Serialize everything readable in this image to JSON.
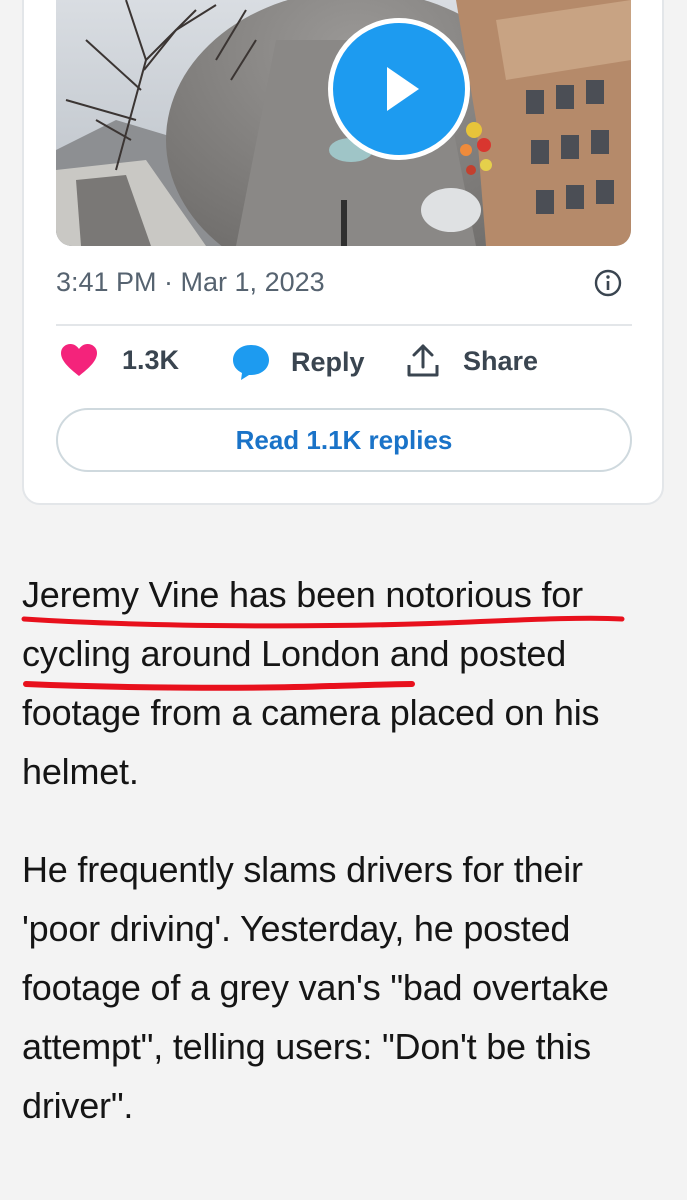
{
  "tweet": {
    "timestamp": "3:41 PM · Mar 1, 2023",
    "likes": "1.3K",
    "reply_label": "Reply",
    "share_label": "Share",
    "read_replies_label": "Read 1.1K replies"
  },
  "article": {
    "paragraph1": "Jeremy Vine has been notorious for cycling around London and posted footage from a camera placed on his helmet.",
    "paragraph2": "He frequently slams drivers for their 'poor driving'. Yesterday, he posted footage of a grey van's \"bad overtake attempt\", telling users: \"Don't be this driver\"."
  },
  "colors": {
    "like": "#f4237b",
    "reply_icon": "#1d9bf0",
    "link": "#1a73c8",
    "annotation": "#e8101c"
  },
  "icons": [
    "play-icon",
    "info-icon",
    "heart-icon",
    "speech-bubble-icon",
    "share-icon"
  ]
}
